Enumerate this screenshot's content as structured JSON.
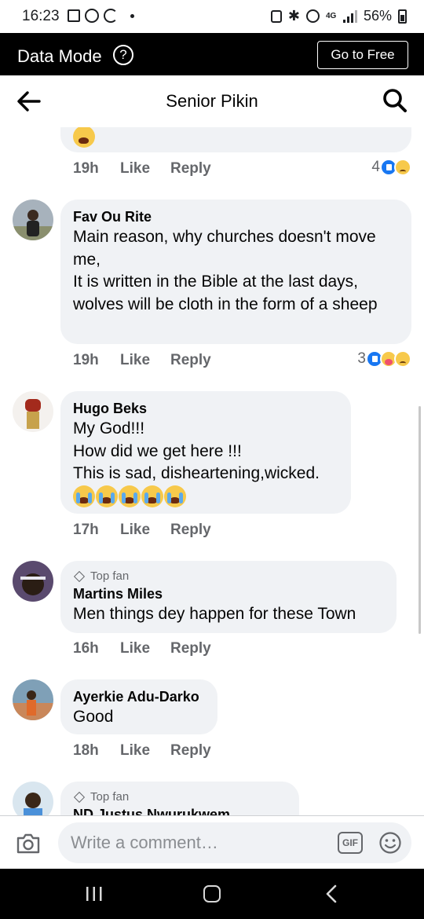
{
  "status_bar": {
    "time": "16:23",
    "network": "4G",
    "battery": "56%"
  },
  "data_bar": {
    "label": "Data Mode",
    "help_glyph": "?",
    "cta": "Go to Free"
  },
  "header": {
    "title": "Senior Pikin"
  },
  "comments": [
    {
      "author": "",
      "text": "",
      "emoji": [
        "sad"
      ],
      "time": "19h",
      "like": "Like",
      "reply": "Reply",
      "reaction_count": "4",
      "reactions": [
        "like",
        "sad"
      ]
    },
    {
      "author": "Fav Ou Rite",
      "text": "Main reason, why churches doesn't move me,\nIt is written in the Bible at the last days, wolves will be cloth in the form of a sheep",
      "time": "19h",
      "like": "Like",
      "reply": "Reply",
      "reaction_count": "3",
      "reactions": [
        "like",
        "care",
        "sad"
      ]
    },
    {
      "author": "Hugo Beks",
      "text": "My God!!!\nHow did we get here !!!\nThis is sad, disheartening,wicked.",
      "emoji": [
        "crying",
        "crying",
        "crying",
        "crying",
        "crying"
      ],
      "time": "17h",
      "like": "Like",
      "reply": "Reply"
    },
    {
      "badge": "Top fan",
      "author": "Martins Miles",
      "text": "Men things dey happen for these Town",
      "time": "16h",
      "like": "Like",
      "reply": "Reply"
    },
    {
      "author": "Ayerkie Adu-Darko",
      "text": "Good",
      "time": "18h",
      "like": "Like",
      "reply": "Reply"
    },
    {
      "badge": "Top fan",
      "author": "ND Justus Nwurukwem"
    }
  ],
  "composer": {
    "placeholder": "Write a comment…",
    "gif_label": "GIF"
  },
  "icons": {
    "back": "arrow-left-icon",
    "search": "search-icon",
    "camera": "camera-icon",
    "gif": "gif-icon",
    "emoji": "smiley-icon"
  },
  "colors": {
    "bubble": "#f0f2f5",
    "secondary_text": "#65676b",
    "like_blue": "#1877f2",
    "data_bar": "#000000"
  }
}
